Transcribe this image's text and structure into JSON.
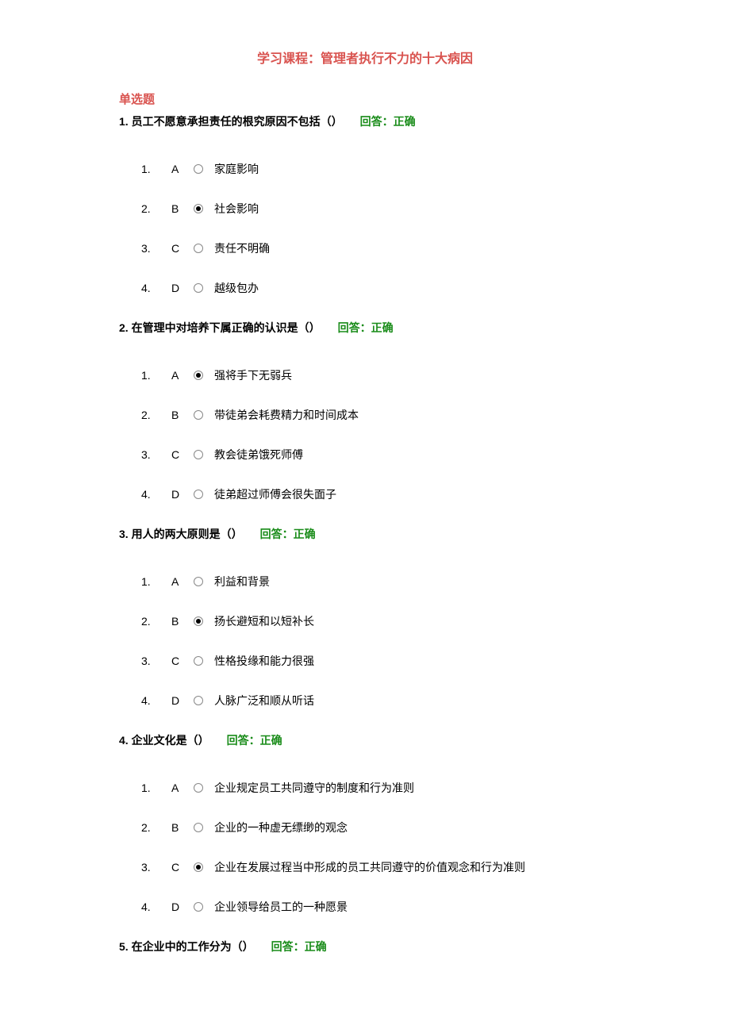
{
  "course_title": "学习课程：管理者执行不力的十大病因",
  "section_heading": "单选题",
  "answer_label": "回答：正确",
  "questions": [
    {
      "stem": "1. 员工不愿意承担责任的根究原因不包括（）",
      "options": [
        {
          "num": "1.",
          "letter": "A",
          "text": "家庭影响",
          "selected": false
        },
        {
          "num": "2.",
          "letter": "B",
          "text": "社会影响",
          "selected": true
        },
        {
          "num": "3.",
          "letter": "C",
          "text": "责任不明确",
          "selected": false
        },
        {
          "num": "4.",
          "letter": "D",
          "text": "越级包办",
          "selected": false
        }
      ]
    },
    {
      "stem": "2. 在管理中对培养下属正确的认识是（）",
      "options": [
        {
          "num": "1.",
          "letter": "A",
          "text": "强将手下无弱兵",
          "selected": true
        },
        {
          "num": "2.",
          "letter": "B",
          "text": "带徒弟会耗费精力和时间成本",
          "selected": false
        },
        {
          "num": "3.",
          "letter": "C",
          "text": "教会徒弟饿死师傅",
          "selected": false
        },
        {
          "num": "4.",
          "letter": "D",
          "text": "徒弟超过师傅会很失面子",
          "selected": false
        }
      ]
    },
    {
      "stem": "3. 用人的两大原则是（）",
      "options": [
        {
          "num": "1.",
          "letter": "A",
          "text": "利益和背景",
          "selected": false
        },
        {
          "num": "2.",
          "letter": "B",
          "text": "扬长避短和以短补长",
          "selected": true
        },
        {
          "num": "3.",
          "letter": "C",
          "text": "性格投缘和能力很强",
          "selected": false
        },
        {
          "num": "4.",
          "letter": "D",
          "text": "人脉广泛和顺从听话",
          "selected": false
        }
      ]
    },
    {
      "stem": "4. 企业文化是（）",
      "options": [
        {
          "num": "1.",
          "letter": "A",
          "text": "企业规定员工共同遵守的制度和行为准则",
          "selected": false
        },
        {
          "num": "2.",
          "letter": "B",
          "text": "企业的一种虚无缥缈的观念",
          "selected": false
        },
        {
          "num": "3.",
          "letter": "C",
          "text": "企业在发展过程当中形成的员工共同遵守的价值观念和行为准则",
          "selected": true
        },
        {
          "num": "4.",
          "letter": "D",
          "text": "企业领导给员工的一种愿景",
          "selected": false
        }
      ]
    },
    {
      "stem": "5. 在企业中的工作分为（）",
      "options": []
    }
  ]
}
